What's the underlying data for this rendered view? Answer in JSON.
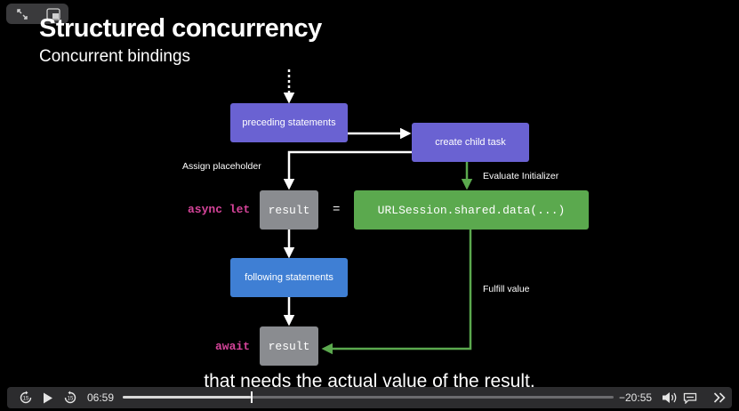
{
  "slide": {
    "title": "Structured concurrency",
    "subtitle": "Concurrent bindings"
  },
  "diagram": {
    "preceding": "preceding statements",
    "create_child": "create child task",
    "assign_placeholder": "Assign placeholder",
    "evaluate_initializer": "Evaluate Initializer",
    "async_let": "async let",
    "result": "result",
    "equals": "=",
    "initializer": "URLSession.shared.data(...)",
    "following": "following statements",
    "fulfill_value": "Fulfill value",
    "await": "await",
    "await_result": "result"
  },
  "caption": "that needs the actual value of the result.",
  "player": {
    "elapsed": "06:59",
    "remaining": "−20:55",
    "progress": 0.26,
    "icons": [
      "expand-icon",
      "picture-in-picture-icon",
      "skip-back-15-icon",
      "play-icon",
      "skip-forward-15-icon",
      "volume-icon",
      "subtitles-icon",
      "airplay-icon",
      "more-icon"
    ]
  },
  "colors": {
    "purple": "#6a62d2",
    "blue": "#3f7fd4",
    "gray": "#8a8c90",
    "green": "#5ba94e",
    "keyword": "#d6449a"
  }
}
